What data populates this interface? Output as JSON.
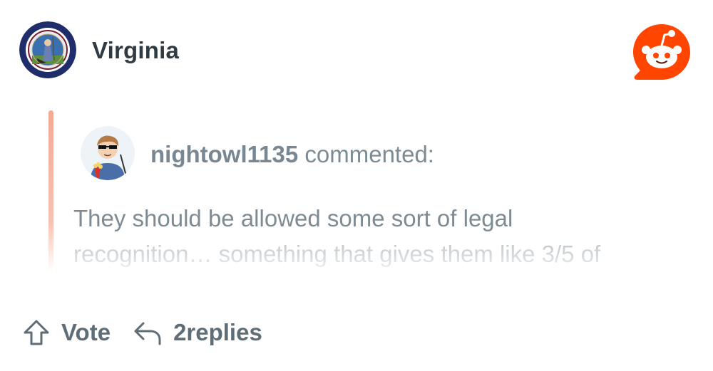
{
  "header": {
    "subreddit_name": "Virginia",
    "subreddit_icon": "virginia-seal-icon",
    "app_icon": "reddit-snoo-icon",
    "brand_color": "#ff4500"
  },
  "comment": {
    "username": "nightowl1135",
    "action_text": "commented:",
    "text_line_1": "They should be allowed some sort of legal",
    "text_line_2": "recognition… something that gives them like 3/5 of",
    "quote_bar_color": "#f4a995",
    "avatar_icon": "user-avatar-icon"
  },
  "actions": {
    "vote_label": "Vote",
    "vote_icon": "upvote-arrow-icon",
    "replies_label": "2replies",
    "reply_icon": "reply-arrow-icon"
  }
}
